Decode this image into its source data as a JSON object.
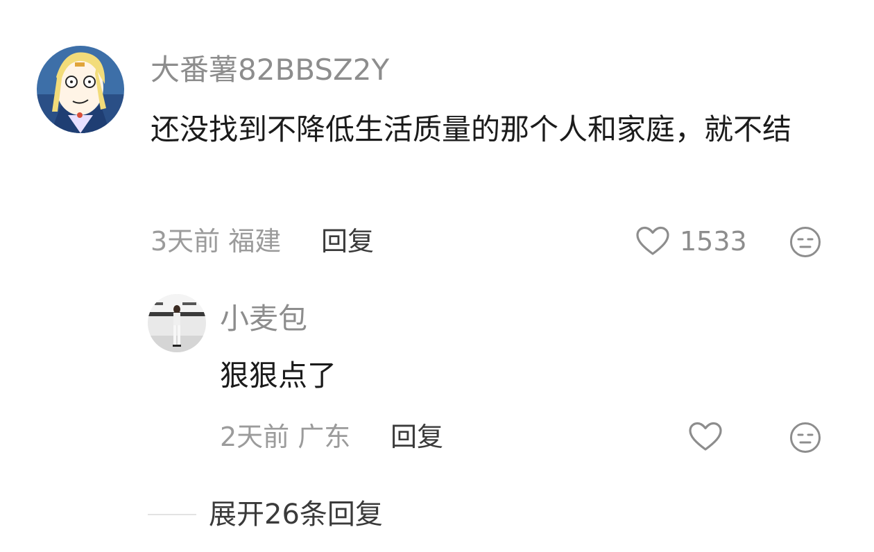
{
  "comment": {
    "username": "大番薯82BBSZ2Y",
    "text": "还没找到不降低生活质量的那个人和家庭，就不结",
    "time": "3天前",
    "location": "福建",
    "reply_label": "回复",
    "like_count": "1533",
    "avatar_icon": "cartoon-avatar-icon"
  },
  "reply": {
    "username": "小麦包",
    "text": "狠狠点了",
    "time": "2天前",
    "location": "广东",
    "reply_label": "回复",
    "avatar_icon": "photo-avatar-icon"
  },
  "expand": {
    "label": "展开26条回复"
  },
  "colors": {
    "username": "#8d8d8d",
    "text": "#1b1b1b",
    "meta": "#9b9b9b",
    "action": "#3a3a3a"
  }
}
